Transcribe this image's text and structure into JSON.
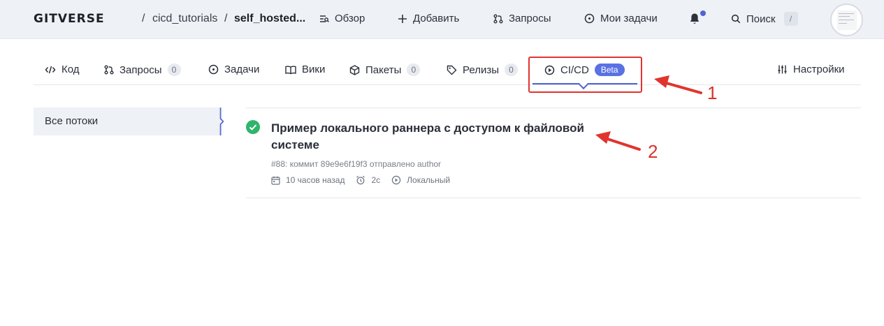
{
  "header": {
    "logo": "GITVERSE",
    "breadcrumb": {
      "owner": "cicd_tutorials",
      "repo": "self_hosted...",
      "separator": "/"
    },
    "nav": [
      {
        "label": "Обзор",
        "icon": "overview-icon"
      },
      {
        "label": "Добавить",
        "icon": "plus-icon"
      },
      {
        "label": "Запросы",
        "icon": "pull-request-icon"
      },
      {
        "label": "Мои задачи",
        "icon": "issue-icon"
      }
    ],
    "search": {
      "label": "Поиск",
      "shortcut": "/"
    },
    "notification_indicator_color": "#4f63d8"
  },
  "tabs": [
    {
      "label": "Код",
      "icon": "code-icon"
    },
    {
      "label": "Запросы",
      "icon": "pull-request-icon",
      "count": "0"
    },
    {
      "label": "Задачи",
      "icon": "issue-icon"
    },
    {
      "label": "Вики",
      "icon": "book-icon"
    },
    {
      "label": "Пакеты",
      "icon": "package-icon",
      "count": "0"
    },
    {
      "label": "Релизы",
      "icon": "tag-icon",
      "count": "0"
    },
    {
      "label": "CI/CD",
      "icon": "play-circle-icon",
      "badge": "Beta",
      "active": true
    },
    {
      "label": "Настройки",
      "icon": "settings-sliders-icon"
    }
  ],
  "sidebar": {
    "items": [
      {
        "label": "Все потоки",
        "active": true
      }
    ]
  },
  "runs": [
    {
      "status": "success",
      "title": "Пример локального раннера с доступом к файловой системе",
      "meta": "#88: коммит 89e9e6f19f3 отправлено author",
      "time_ago": "10 часов назад",
      "duration": "2с",
      "runner": "Локальный"
    }
  ],
  "annotations": [
    {
      "label": "1"
    },
    {
      "label": "2"
    }
  ],
  "colors": {
    "accent": "#4f63d8",
    "success": "#2fb56b",
    "annotation": "#e0342e"
  }
}
